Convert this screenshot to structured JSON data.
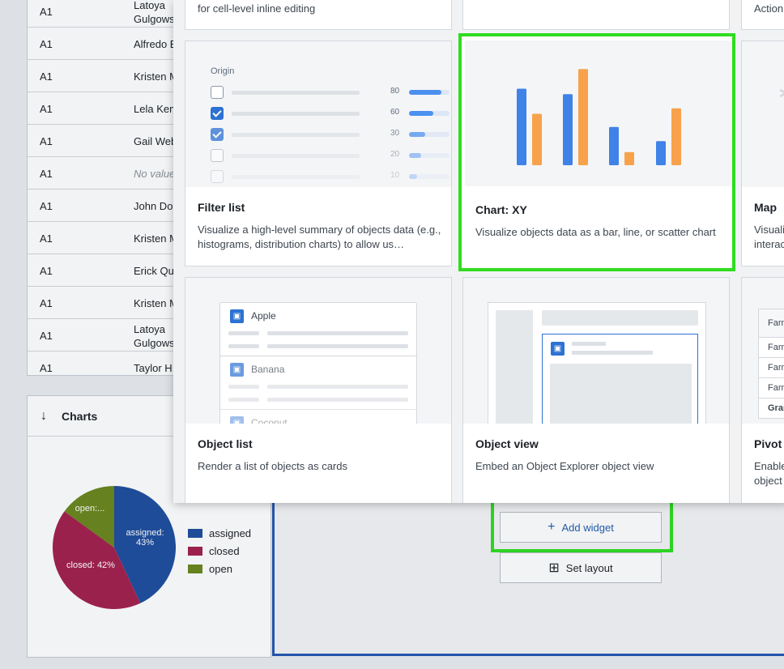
{
  "background_table": {
    "rows": [
      {
        "col1": "A1",
        "col2": "Latoya Gulgows",
        "wrap": true
      },
      {
        "col1": "A1",
        "col2": "Alfredo E"
      },
      {
        "col1": "A1",
        "col2": "Kristen M"
      },
      {
        "col1": "A1",
        "col2": "Lela Kem"
      },
      {
        "col1": "A1",
        "col2": "Gail Web"
      },
      {
        "col1": "A1",
        "col2": "No value",
        "muted": true
      },
      {
        "col1": "A1",
        "col2": "John Do"
      },
      {
        "col1": "A1",
        "col2": "Kristen M"
      },
      {
        "col1": "A1",
        "col2": "Erick Qu"
      },
      {
        "col1": "A1",
        "col2": "Kristen M"
      },
      {
        "col1": "A1",
        "col2": "Latoya Gulgows",
        "wrap": true
      },
      {
        "col1": "A1",
        "col2": "Taylor H"
      }
    ]
  },
  "charts_panel": {
    "title": "Charts",
    "chart_data": {
      "type": "pie",
      "slices": [
        {
          "name": "assigned",
          "value": 43,
          "label": "assigned: 43%",
          "color": "#1f4e9e"
        },
        {
          "name": "closed",
          "value": 42,
          "label": "closed: 42%",
          "color": "#a3204e"
        },
        {
          "name": "open",
          "value": 15,
          "label": "open:...",
          "color": "#6b861d"
        }
      ],
      "legend": [
        "assigned",
        "closed",
        "open"
      ],
      "legend_position": "right"
    }
  },
  "buttons": {
    "add_widget": "Add widget",
    "set_layout": "Set layout"
  },
  "modal": {
    "top_cards": [
      {
        "desc": "for cell-level inline editing"
      },
      {
        "desc": ""
      },
      {
        "desc": "Action"
      }
    ],
    "filter_list": {
      "title": "Filter list",
      "desc": "Visualize a high-level summary of objects data (e.g., histograms, distribution charts) to allow us…",
      "preview_label": "Origin",
      "rows": [
        {
          "count": "80",
          "checked": false,
          "fill": 0.8
        },
        {
          "count": "60",
          "checked": true,
          "fill": 0.6
        },
        {
          "count": "30",
          "checked": true,
          "fill": 0.4
        },
        {
          "count": "20",
          "checked": false,
          "fill": 0.3
        },
        {
          "count": "10",
          "checked": false,
          "fill": 0.2
        }
      ]
    },
    "chart_xy": {
      "title": "Chart: XY",
      "desc": "Visualize objects data as a bar, line, or scatter chart",
      "chart_data": {
        "type": "bar",
        "series": [
          {
            "name": "",
            "values": [
              7,
              6.5,
              3.5,
              2.2
            ],
            "color": "#3f82e8"
          },
          {
            "name": "",
            "values": [
              4.7,
              8.8,
              1.2,
              5.2
            ],
            "color": "#f7a24b"
          }
        ],
        "ylim": [
          0,
          9
        ]
      }
    },
    "map": {
      "title": "Map",
      "desc": "Visuali interac"
    },
    "object_list": {
      "title": "Object list",
      "desc": "Render a list of objects as cards",
      "items": [
        "Apple",
        "Banana",
        "Coconut"
      ]
    },
    "object_view": {
      "title": "Object view",
      "desc": "Embed an Object Explorer object view"
    },
    "pivot": {
      "title": "Pivot",
      "desc": "Enable object",
      "rows": [
        "Farm",
        "Farm",
        "Farm",
        "Farm",
        "Gran"
      ]
    }
  },
  "colors": {
    "accent": "#2d72d2",
    "highlight": "#2fdc1f"
  }
}
